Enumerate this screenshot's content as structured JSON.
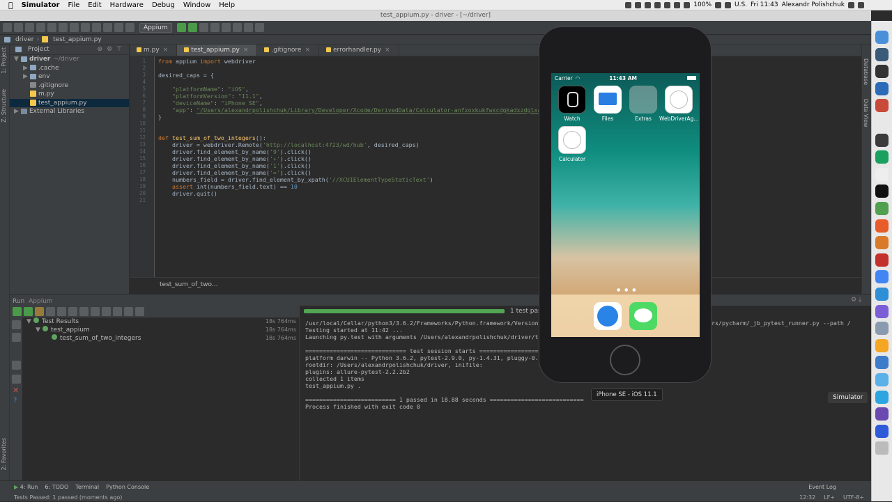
{
  "menubar": {
    "app": "Simulator",
    "items": [
      "File",
      "Edit",
      "Hardware",
      "Debug",
      "Window",
      "Help"
    ],
    "battery": "100%",
    "input": "U.S.",
    "clock": "Fri 11:43",
    "user": "Alexandr Polishchuk"
  },
  "window": {
    "title": "test_appium.py - driver - [~/driver]"
  },
  "toolbar": {
    "run_config": "Appium"
  },
  "navbar": {
    "root": "driver",
    "file": "test_appium.py"
  },
  "project": {
    "header": "Project",
    "items": [
      {
        "label": "driver",
        "suffix": "~/driver",
        "type": "folder",
        "depth": 0
      },
      {
        "label": ".cache",
        "suffix": "",
        "type": "folder",
        "depth": 1
      },
      {
        "label": "env",
        "suffix": "",
        "type": "folder",
        "depth": 1
      },
      {
        "label": ".gitignore",
        "suffix": "",
        "type": "file",
        "depth": 1
      },
      {
        "label": "m.py",
        "suffix": "",
        "type": "py",
        "depth": 1
      },
      {
        "label": "test_appium.py",
        "suffix": "",
        "type": "py",
        "depth": 1,
        "selected": true
      },
      {
        "label": "External Libraries",
        "suffix": "",
        "type": "lib",
        "depth": 0
      }
    ]
  },
  "left_tabs": {
    "project": "1: Project",
    "structure": "Z: Structure",
    "favorites": "2: Favorites"
  },
  "right_tabs": {
    "database": "Database",
    "dataview": "Data View"
  },
  "editor": {
    "tabs": [
      {
        "label": "m.py",
        "active": false
      },
      {
        "label": "test_appium.py",
        "active": true
      },
      {
        "label": ".gitignore",
        "active": false
      },
      {
        "label": "errorhandler.py",
        "active": false
      }
    ],
    "code": [
      [
        [
          "kw",
          "from "
        ],
        [
          "",
          "appium "
        ],
        [
          "kw",
          "import "
        ],
        [
          "",
          "webdriver"
        ]
      ],
      [],
      [
        [
          "",
          "desired_caps = {"
        ]
      ],
      [],
      [
        [
          "",
          "    "
        ],
        [
          "st",
          "\"platformName\""
        ],
        [
          "",
          ": "
        ],
        [
          "st",
          "\"iOS\""
        ],
        [
          "",
          ","
        ]
      ],
      [
        [
          "",
          "    "
        ],
        [
          "st",
          "\"platformVersion\""
        ],
        [
          "",
          ": "
        ],
        [
          "st",
          "\"11.1\""
        ],
        [
          "",
          ","
        ]
      ],
      [
        [
          "",
          "    "
        ],
        [
          "st",
          "\"deviceName\""
        ],
        [
          "",
          ": "
        ],
        [
          "st",
          "\"iPhone SE\""
        ],
        [
          "",
          ","
        ]
      ],
      [
        [
          "",
          "    "
        ],
        [
          "st",
          "\"app\""
        ],
        [
          "",
          ": "
        ],
        [
          "stul",
          "\"/Users/alexandrpolishchuk/Library/Developer/Xcode/DerivedData/Calculator-anfzoxkukfwxcdgkadxzdglxaxdv/Bu"
        ]
      ],
      [
        [
          "",
          "}"
        ]
      ],
      [],
      [],
      [
        [
          "kw",
          "def "
        ],
        [
          "fn",
          "test_sum_of_two_integers"
        ],
        [
          "",
          "():"
        ]
      ],
      [
        [
          "",
          "    driver = webdriver.Remote("
        ],
        [
          "st",
          "'http://localhost:4723/wd/hub'"
        ],
        [
          "",
          ", desired_caps)"
        ]
      ],
      [
        [
          "",
          "    driver.find_element_by_name("
        ],
        [
          "st",
          "'9'"
        ],
        [
          "",
          ").click()"
        ]
      ],
      [
        [
          "",
          "    driver.find_element_by_name("
        ],
        [
          "st",
          "'+'"
        ],
        [
          "",
          ").click()"
        ]
      ],
      [
        [
          "",
          "    driver.find_element_by_name("
        ],
        [
          "st",
          "'1'"
        ],
        [
          "",
          ").click()"
        ]
      ],
      [
        [
          "",
          "    driver.find_element_by_name("
        ],
        [
          "st",
          "'='"
        ],
        [
          "",
          ").click()"
        ]
      ],
      [
        [
          "",
          "    numbers_field = driver.find_element_by_xpath("
        ],
        [
          "st",
          "'//XCUIElementTypeStaticText'"
        ],
        [
          "",
          ")"
        ]
      ],
      [
        [
          "",
          "    "
        ],
        [
          "kw",
          "assert "
        ],
        [
          "",
          "int(numbers_field.text) == "
        ],
        [
          "nm",
          "10"
        ]
      ],
      [
        [
          "",
          "    driver.quit()"
        ]
      ],
      []
    ],
    "breadcrumb": "test_sum_of_two..."
  },
  "run": {
    "header": "Run",
    "config": "Appium",
    "tree": [
      {
        "label": "Test Results",
        "time": "18s 764ms",
        "depth": 0
      },
      {
        "label": "test_appium",
        "time": "18s 764ms",
        "depth": 1
      },
      {
        "label": "test_sum_of_two_integers",
        "time": "18s 764ms",
        "depth": 2
      }
    ],
    "progress": 1.0,
    "progress_label": "1 test pas",
    "output": [
      "/usr/local/Cellar/python3/3.6.2/Frameworks/Python.framework/Versions/3.6",
      "Testing started at 11:42 ...",
      "Launching py.test with arguments /Users/alexandrpolishchuk/driver/test_a",
      "",
      "============================= test session starts ==================",
      "platform darwin -- Python 3.6.2, pytest-2.9.0, py-1.4.31, pluggy-0.3.1",
      "rootdir: /Users/alexandrpolishchuk/driver, inifile:",
      "plugins: allure-pytest-2.2.2b2",
      "collected 1 items",
      "test_appium.py .",
      "",
      "========================== 1 passed in 18.88 seconds ===========================",
      "Process finished with exit code 0"
    ],
    "output_right": "ers/pycharm/_jb_pytest_runner.py --path /"
  },
  "bottom_tabs": [
    "4: Run",
    "6: TODO",
    "Terminal",
    "Python Console"
  ],
  "event_log": "Event Log",
  "status": {
    "text": "Tests Passed: 1 passed (moments ago)",
    "position": "12:32",
    "line_sep": "LF÷",
    "encoding": "UTF-8÷"
  },
  "simulator": {
    "carrier": "Carrier",
    "time": "11:43 AM",
    "apps": [
      "Watch",
      "Files",
      "Extras",
      "WebDriverAg...",
      "Calculator"
    ],
    "device_label": "iPhone SE - iOS 11.1"
  },
  "dock_tooltip": "Simulator",
  "colors": {
    "ide_bg": "#2b2b2b",
    "panel": "#3c3f41",
    "accent_green": "#53a653",
    "keyword": "#cc7832",
    "string": "#6a8759"
  }
}
